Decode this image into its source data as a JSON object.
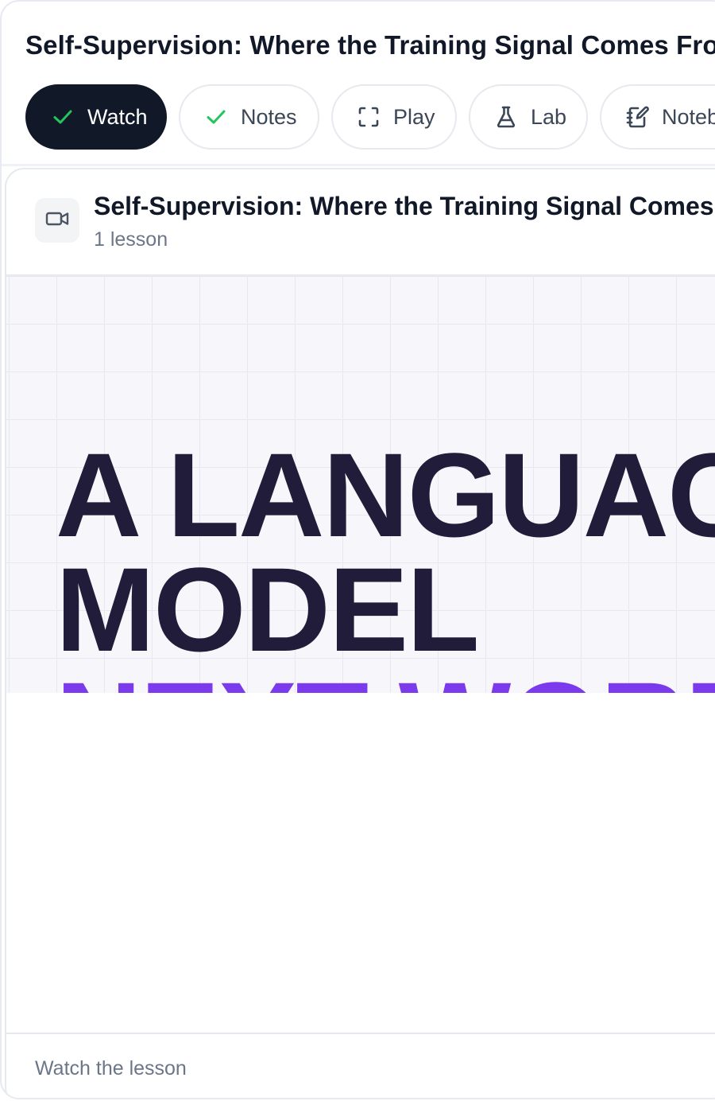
{
  "page": {
    "title": "Self-Supervision: Where the Training Signal Comes From"
  },
  "tabs": [
    {
      "label": "Watch",
      "icon": "check-icon",
      "active": true
    },
    {
      "label": "Notes",
      "icon": "check-icon",
      "active": false
    },
    {
      "label": "Play",
      "icon": "fullscreen-icon",
      "active": false
    },
    {
      "label": "Lab",
      "icon": "flask-icon",
      "active": false
    },
    {
      "label": "Notebook",
      "icon": "notebook-edit-icon",
      "active": false
    }
  ],
  "lesson": {
    "title": "Self-Supervision: Where the Training Signal Comes From",
    "count": "1 lesson",
    "icon": "video-camera-icon"
  },
  "video": {
    "line1": "A LANGUAGE",
    "line2": "MODEL",
    "line3": "NEXT WORD"
  },
  "footer": {
    "text": "Watch the lesson"
  },
  "colors": {
    "active_tab_bg": "#111827",
    "check_green": "#22c55e",
    "video_text_dark": "#201c3a",
    "video_text_accent": "#7c3aed"
  }
}
